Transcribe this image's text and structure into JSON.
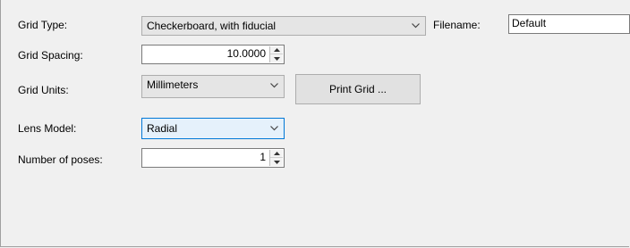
{
  "grid_type": {
    "label": "Grid Type:",
    "value": "Checkerboard, with fiducial"
  },
  "filename": {
    "label": "Filename:",
    "value": "Default"
  },
  "grid_spacing": {
    "label": "Grid Spacing:",
    "value": "10.0000"
  },
  "grid_units": {
    "label": "Grid Units:",
    "value": "Millimeters"
  },
  "print_grid": {
    "label": "Print Grid ..."
  },
  "lens_model": {
    "label": "Lens Model:",
    "value": "Radial"
  },
  "number_of_poses": {
    "label": "Number of poses:",
    "value": "1"
  },
  "colors": {
    "focus_accent": "#0078d7",
    "combo_bg": "#e5e5e5",
    "focus_bg": "#e5f1fb"
  },
  "icons": {
    "dropdown": "chevron-down-icon",
    "spin_up": "triangle-up-icon",
    "spin_down": "triangle-down-icon"
  }
}
